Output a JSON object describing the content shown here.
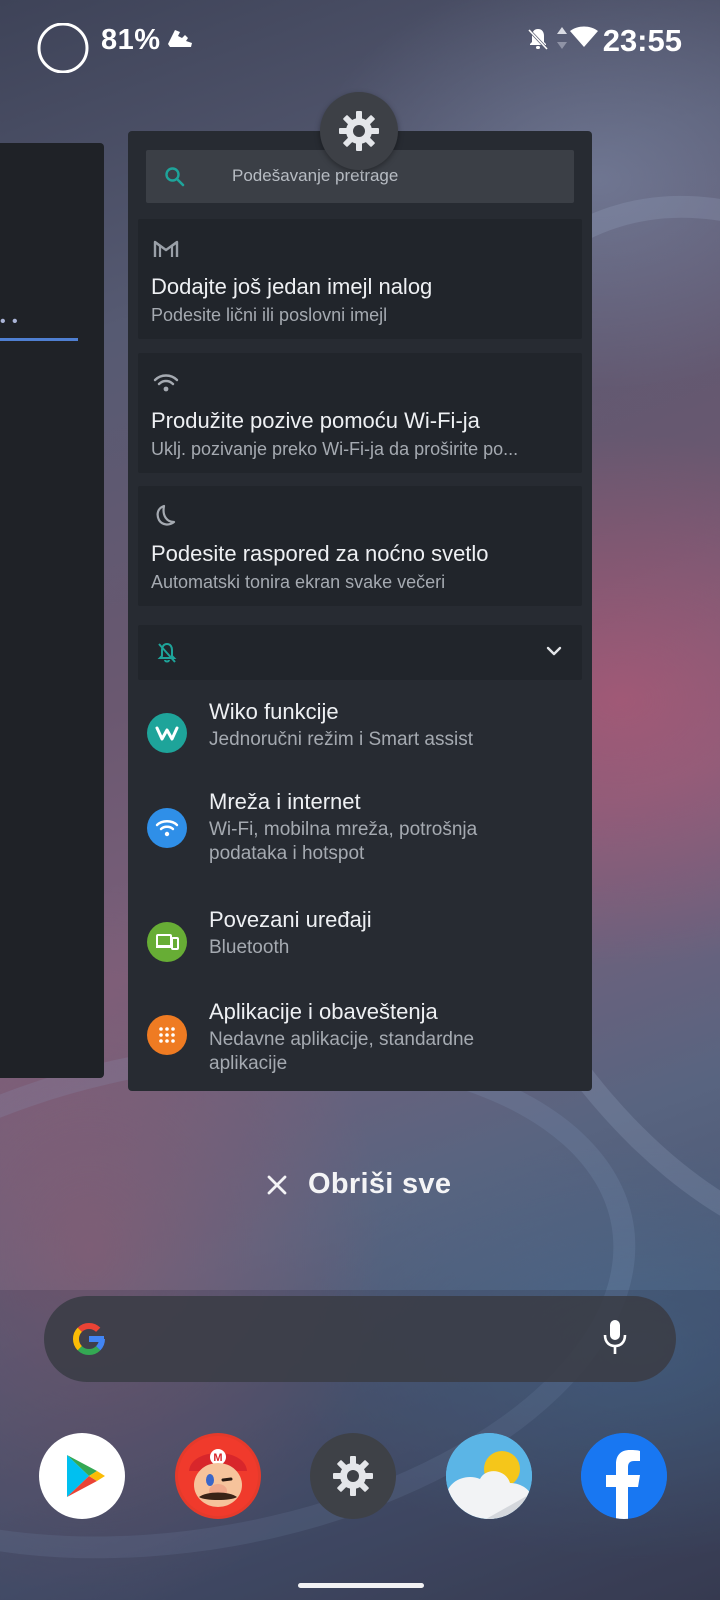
{
  "status_bar": {
    "battery_percent": "81%",
    "time": "23:55",
    "icons": [
      "battery-ring-icon",
      "shoe-icon",
      "bell-off-icon",
      "data-arrows-icon",
      "wifi-icon"
    ]
  },
  "left_card": {
    "dots": "• •"
  },
  "settings_card": {
    "header_icon": "gear-icon",
    "search_placeholder": "Podešavanje pretrage",
    "suggestions": [
      {
        "icon": "gmail-icon",
        "title": "Dodajte još jedan imejl nalog",
        "subtitle": "Podesite lični ili poslovni imejl"
      },
      {
        "icon": "wifi-icon",
        "title": "Produžite pozive pomoću Wi-Fi-ja",
        "subtitle": "Uklj. pozivanje preko Wi-Fi-ja da proširite po..."
      },
      {
        "icon": "moon-icon",
        "title": "Podesite raspored za noćno svetlo",
        "subtitle": "Automatski tonira ekran svake večeri"
      }
    ],
    "condition": {
      "icon": "bell-off-icon",
      "expand_icon": "chevron-down-icon"
    },
    "items": [
      {
        "icon": "wiko-icon",
        "color": "#1ea49a",
        "title": "Wiko funkcije",
        "subtitle": "Jednoručni režim i Smart assist"
      },
      {
        "icon": "wifi-icon",
        "color": "#2f8fe8",
        "title": "Mreža i internet",
        "subtitle": "Wi-Fi, mobilna mreža, potrošnja podataka i hotspot"
      },
      {
        "icon": "devices-icon",
        "color": "#67ad35",
        "title": "Povezani uređaji",
        "subtitle": "Bluetooth"
      },
      {
        "icon": "apps-grid-icon",
        "color": "#ef7b22",
        "title": "Aplikacije i obaveštenja",
        "subtitle": "Nedavne aplikacije, standardne aplikacije"
      }
    ]
  },
  "clear_all": {
    "label": "Obriši sve",
    "icon": "close-icon"
  },
  "google_search": {
    "logo": "google-logo-icon",
    "mic": "microphone-icon"
  },
  "dock": [
    {
      "name": "play-store-icon"
    },
    {
      "name": "super-mario-icon"
    },
    {
      "name": "settings-icon"
    },
    {
      "name": "weather-icon"
    },
    {
      "name": "facebook-icon"
    }
  ],
  "colors": {
    "card_bg": "#272b32",
    "suggestion_bg": "#21252b",
    "accent_teal": "#1ea49a",
    "accent_blue": "#2f8fe8",
    "accent_green": "#67ad35",
    "accent_orange": "#ef7b22"
  }
}
